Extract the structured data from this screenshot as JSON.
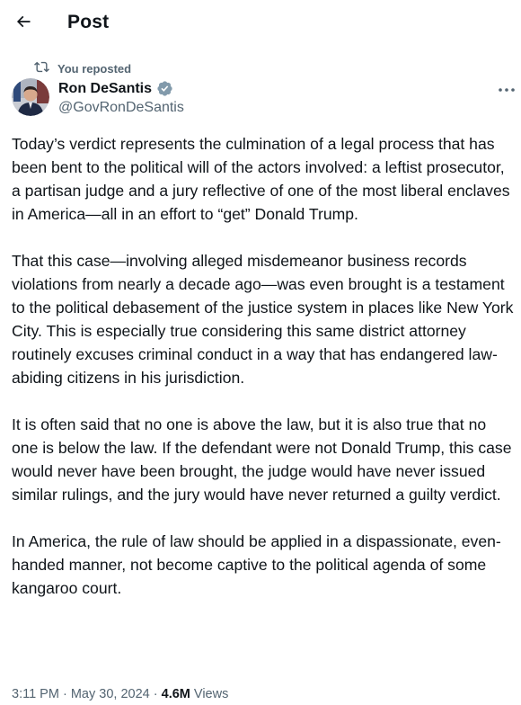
{
  "header": {
    "title": "Post",
    "back_icon": "arrow-left-icon"
  },
  "repost": {
    "label": "You reposted",
    "icon": "repost-icon"
  },
  "author": {
    "name": "Ron DeSantis",
    "handle": "@GovRonDeSantis",
    "verified_icon": "verified-badge-icon",
    "verified_color": "#829aab"
  },
  "more_icon": "more-horizontal-icon",
  "tweet": {
    "paragraphs": [
      "Today’s verdict represents the culmination of a legal process that has been bent to the political will of the actors involved: a leftist prosecutor, a partisan judge and a jury reflective of one of the most liberal enclaves in America—all in an effort to “get” Donald Trump.",
      "That this case—involving alleged misdemeanor business records violations from nearly a decade ago—was even brought is a testament to the political debasement of the justice system in places like New York City. This is especially true considering this same district attorney routinely excuses criminal conduct in a way that has endangered law-abiding citizens in his jurisdiction.",
      "It is often said that no one is above the law, but it is also true that no one is below the law. If the defendant were not Donald Trump, this case would never have been brought, the judge would have never issued similar rulings, and the jury would have never returned a guilty verdict.",
      "In America, the rule of law should be applied in a dispassionate, even-handed manner, not become captive to the political agenda of some kangaroo court."
    ]
  },
  "meta": {
    "time": "3:11 PM",
    "separator": "·",
    "date": "May 30, 2024",
    "views_count": "4.6M",
    "views_label": "Views"
  },
  "colors": {
    "text_primary": "#0f1419",
    "text_secondary": "#536471",
    "background": "#ffffff"
  }
}
